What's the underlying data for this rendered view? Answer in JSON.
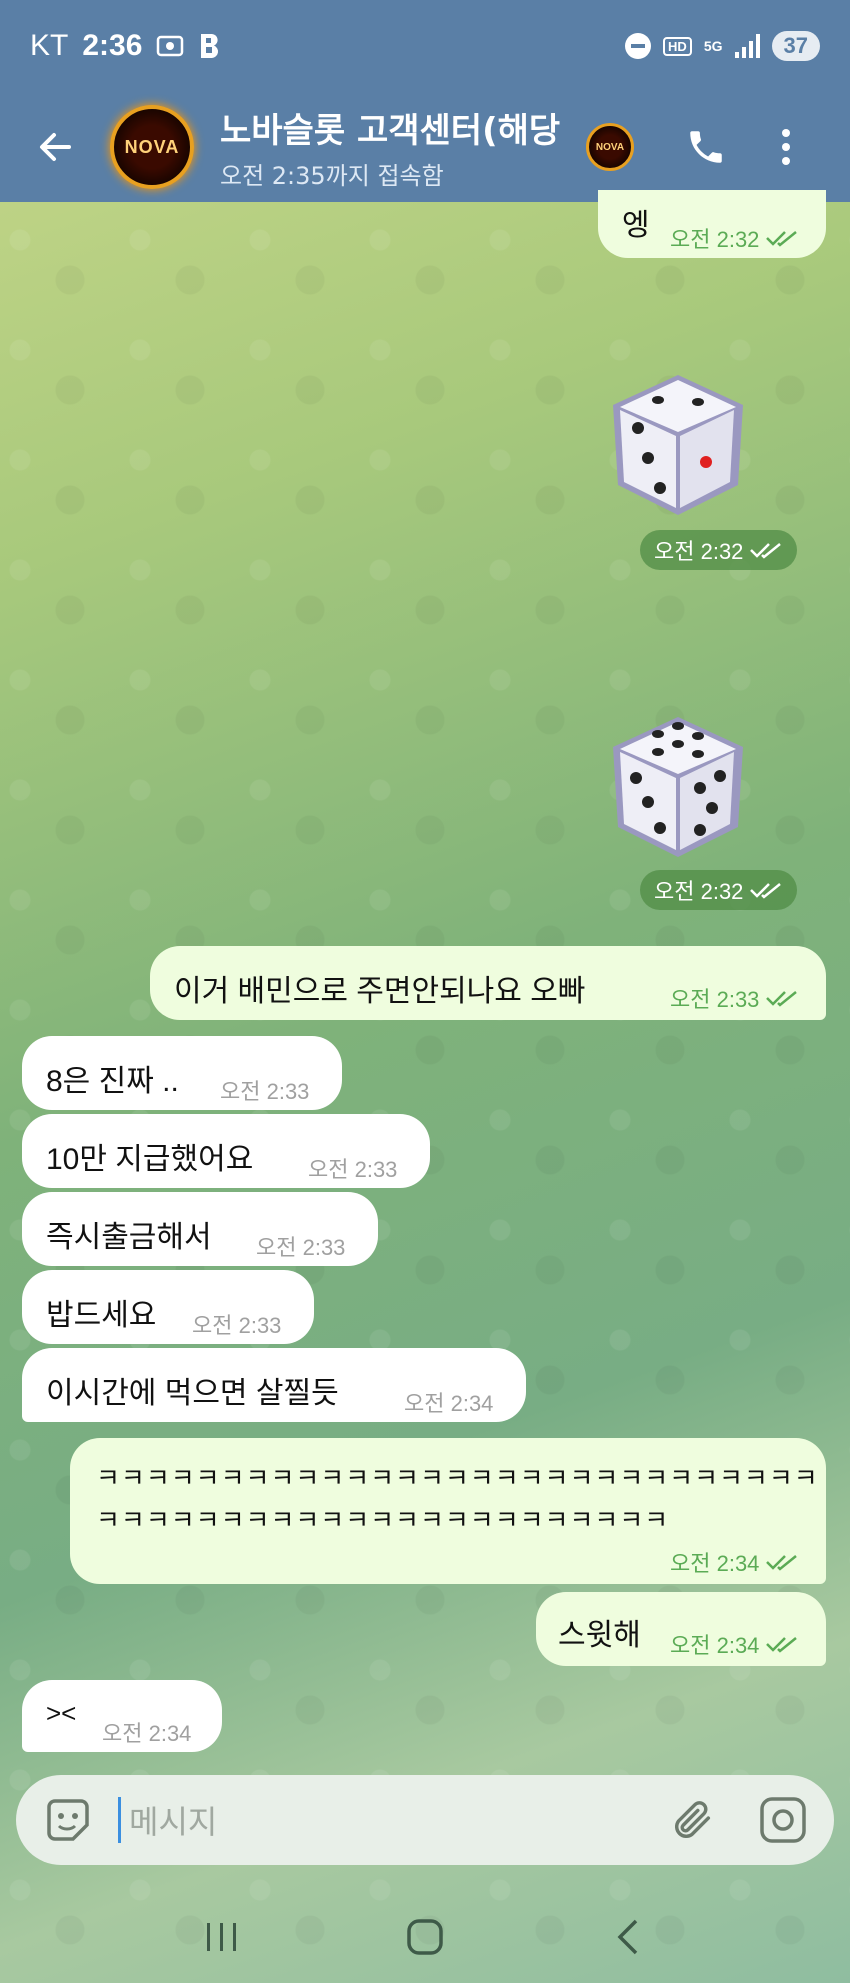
{
  "status_bar": {
    "carrier": "KT",
    "time": "2:36",
    "battery": "37",
    "hd_label": "HD",
    "network_label": "5G"
  },
  "header": {
    "title": "노바슬롯 고객센터(해당",
    "status": "오전 2:35까지 접속함",
    "avatar_text": "NOVA"
  },
  "messages": [
    {
      "dir": "out",
      "text": "엥",
      "time": "오전 2:32",
      "read": true
    },
    {
      "dir": "out",
      "type": "dice",
      "time": "오전 2:32",
      "read": true
    },
    {
      "dir": "out",
      "type": "dice",
      "time": "오전 2:32",
      "read": true
    },
    {
      "dir": "out",
      "text": "이거 배민으로 주면안되나요 오빠",
      "time": "오전 2:33",
      "read": true
    },
    {
      "dir": "in",
      "text": "8은 진짜 ..",
      "time": "오전 2:33"
    },
    {
      "dir": "in",
      "text": "10만 지급했어요",
      "time": "오전 2:33"
    },
    {
      "dir": "in",
      "text": "즉시출금해서",
      "time": "오전 2:33"
    },
    {
      "dir": "in",
      "text": "밥드세요",
      "time": "오전 2:33"
    },
    {
      "dir": "in",
      "text": "이시간에 먹으면 살찔듯",
      "time": "오전 2:34"
    },
    {
      "dir": "out",
      "text_line1": "ㅋㅋㅋㅋㅋㅋㅋㅋㅋㅋㅋㅋㅋㅋㅋㅋㅋㅋㅋㅋㅋㅋㅋㅋㅋㅋㅋㅋㅋ",
      "text_line2": "ㅋㅋㅋㅋㅋㅋㅋㅋㅋㅋㅋㅋㅋㅋㅋㅋㅋㅋㅋㅋㅋㅋㅋ",
      "time": "오전 2:34",
      "read": true
    },
    {
      "dir": "out",
      "text": "스윗해",
      "time": "오전 2:34",
      "read": true
    },
    {
      "dir": "in",
      "text": "><",
      "time": "오전 2:34"
    }
  ],
  "input": {
    "placeholder": "메시지"
  },
  "icons": {
    "back": "arrow-left-icon",
    "call": "phone-icon",
    "menu": "more-vertical-icon",
    "emoji": "sticker-emoji-icon",
    "attach": "paperclip-icon",
    "camera": "camera-icon",
    "nav_recents": "recents-icon",
    "nav_home": "home-icon",
    "nav_back": "nav-back-icon"
  },
  "colors": {
    "header_bg": "#5a7fa6",
    "outgoing_bubble": "#effdde",
    "incoming_bubble": "#ffffff",
    "read_check": "#5bab55"
  }
}
